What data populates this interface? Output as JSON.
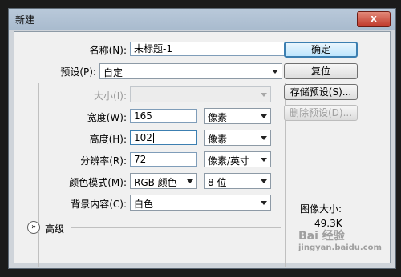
{
  "window": {
    "title": "新建",
    "close_label": "x"
  },
  "fields": {
    "name": {
      "label": "名称(N):",
      "value": "未标题-1"
    },
    "preset": {
      "label": "预设(P):",
      "value": "自定"
    },
    "size": {
      "label": "大小(I):",
      "value": ""
    },
    "width": {
      "label": "宽度(W):",
      "value": "165",
      "unit": "像素"
    },
    "height": {
      "label": "高度(H):",
      "value": "102",
      "unit": "像素"
    },
    "resolution": {
      "label": "分辨率(R):",
      "value": "72",
      "unit": "像素/英寸"
    },
    "color_mode": {
      "label": "颜色模式(M):",
      "mode": "RGB 颜色",
      "bits": "8 位"
    },
    "background": {
      "label": "背景内容(C):",
      "value": "白色"
    }
  },
  "buttons": {
    "ok": "确定",
    "reset": "复位",
    "save_preset": "存储预设(S)...",
    "delete_preset": "删除预设(D)..."
  },
  "advanced": {
    "label": "高级"
  },
  "image_size": {
    "label": "图像大小:",
    "value": "49.3K"
  },
  "watermark": {
    "brand": "Bai 经验",
    "url": "jingyan.baidu.com"
  }
}
